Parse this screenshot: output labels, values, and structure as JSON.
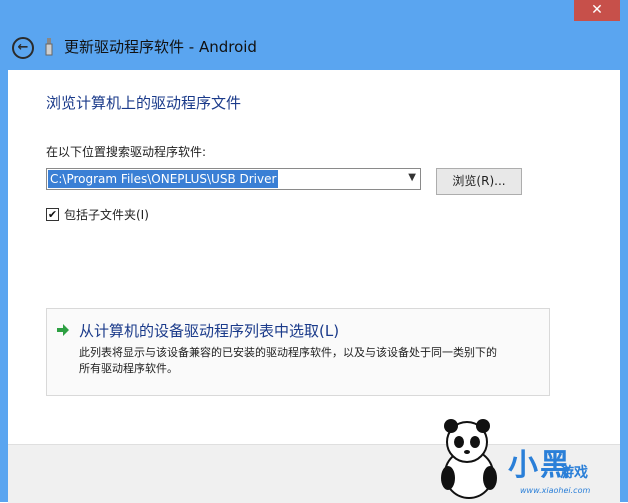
{
  "window": {
    "title": "更新驱动程序软件 - Android",
    "close_glyph": "✕",
    "back_glyph": "←"
  },
  "page": {
    "heading": "浏览计算机上的驱动程序文件",
    "search_label": "在以下位置搜索驱动程序软件:",
    "path_value": "C:\\Program Files\\ONEPLUS\\USB Driver",
    "browse_label": "浏览(R)...",
    "include_subfolders_label": "包括子文件夹(I)",
    "include_subfolders_checked": true
  },
  "option": {
    "title": "从计算机的设备驱动程序列表中选取(L)",
    "desc_line1": "此列表将显示与该设备兼容的已安装的驱动程序软件，以及与该设备处于同一类别下的",
    "desc_line2": "所有驱动程序软件。"
  },
  "watermark": {
    "brand": "小黑",
    "game": "游戏",
    "url": "www.xiaohei.com"
  },
  "colors": {
    "title_bar": "#5aa5f0",
    "accent_text": "#1a3a8a",
    "selection": "#3a7fd5",
    "close": "#c7504a"
  },
  "icons": [
    "back-arrow-icon",
    "usb-device-icon",
    "close-icon",
    "dropdown-arrow-icon",
    "green-arrow-icon",
    "checkbox-check-icon"
  ]
}
